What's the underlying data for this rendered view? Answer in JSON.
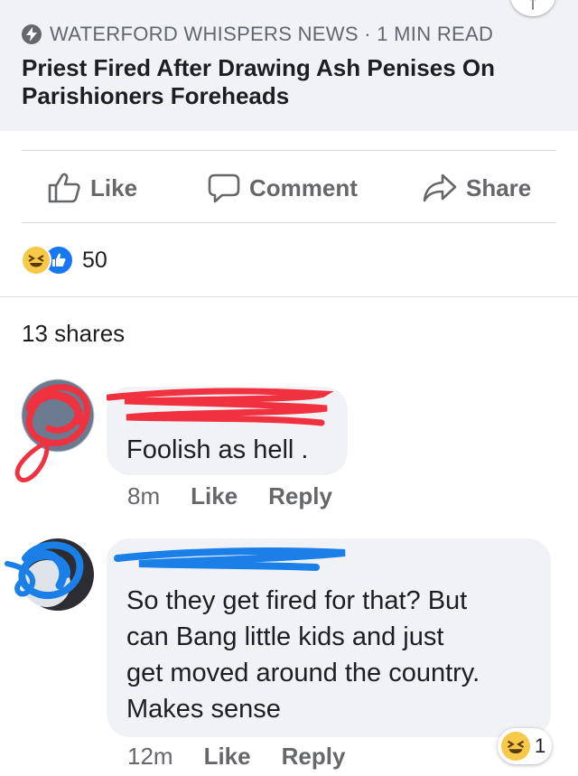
{
  "link_card": {
    "source": "WATERFORD WHISPERS NEWS · 1 MIN READ",
    "headline": "Priest Fired After Drawing Ash Penises On Parishioners Foreheads",
    "source_icon": "lightning-bolt-icon"
  },
  "actions": [
    {
      "label": "Like",
      "icon": "thumbs-up-icon"
    },
    {
      "label": "Comment",
      "icon": "speech-bubble-icon"
    },
    {
      "label": "Share",
      "icon": "share-arrow-icon"
    }
  ],
  "reactions": {
    "types": [
      "haha",
      "like"
    ],
    "count": "50"
  },
  "shares_text": "13 shares",
  "comments": [
    {
      "text": "Foolish as hell .",
      "time": "8m",
      "like_label": "Like",
      "reply_label": "Reply",
      "scribble_color": "#f0313f"
    },
    {
      "text_lines": [
        "So they get fired for that? But",
        "can Bang little kids and just",
        "get moved around the country.",
        "Makes sense"
      ],
      "time": "12m",
      "like_label": "Like",
      "reply_label": "Reply",
      "scribble_color": "#1a7fe6",
      "reaction": {
        "type": "haha",
        "count": "1"
      }
    }
  ],
  "colors": {
    "card_bg": "#f0f2f5",
    "muted_text": "#65676b",
    "like_blue": "#1877f2",
    "haha_yellow": "#f7c948"
  }
}
